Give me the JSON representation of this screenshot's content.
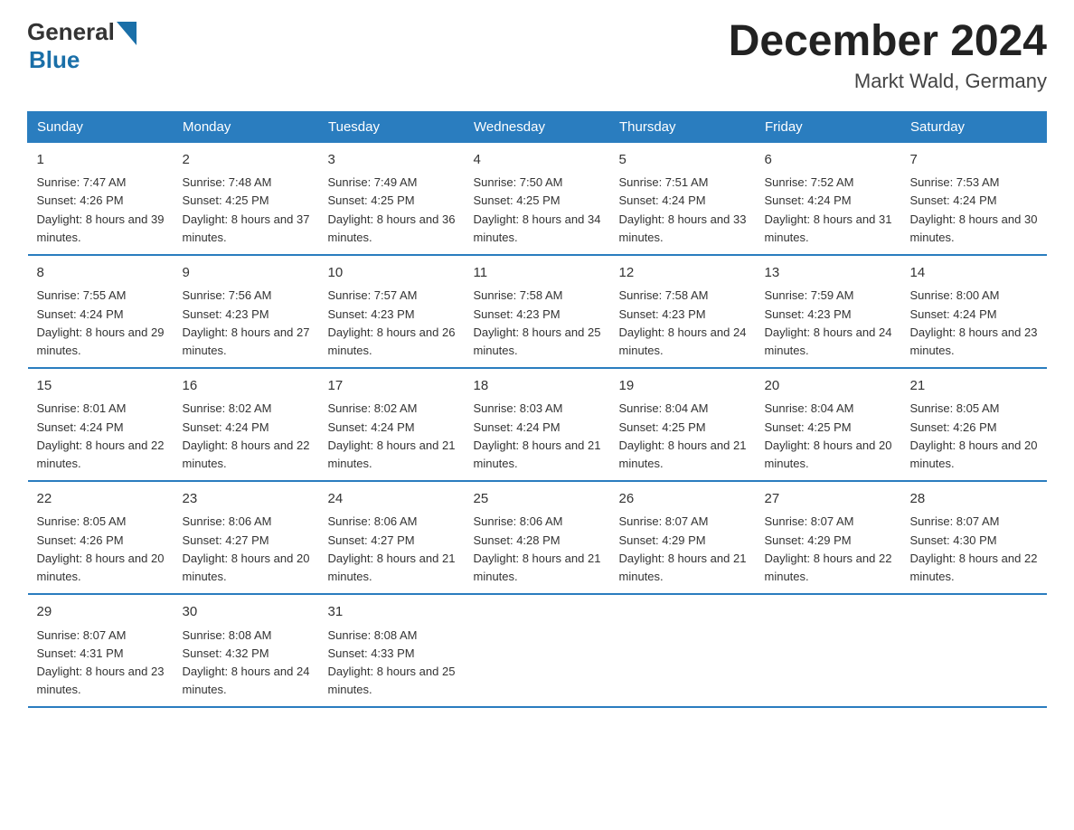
{
  "header": {
    "logo_general": "General",
    "logo_blue": "Blue",
    "month_title": "December 2024",
    "location": "Markt Wald, Germany"
  },
  "days_of_week": [
    "Sunday",
    "Monday",
    "Tuesday",
    "Wednesday",
    "Thursday",
    "Friday",
    "Saturday"
  ],
  "weeks": [
    [
      {
        "day": "1",
        "sunrise": "7:47 AM",
        "sunset": "4:26 PM",
        "daylight": "8 hours and 39 minutes."
      },
      {
        "day": "2",
        "sunrise": "7:48 AM",
        "sunset": "4:25 PM",
        "daylight": "8 hours and 37 minutes."
      },
      {
        "day": "3",
        "sunrise": "7:49 AM",
        "sunset": "4:25 PM",
        "daylight": "8 hours and 36 minutes."
      },
      {
        "day": "4",
        "sunrise": "7:50 AM",
        "sunset": "4:25 PM",
        "daylight": "8 hours and 34 minutes."
      },
      {
        "day": "5",
        "sunrise": "7:51 AM",
        "sunset": "4:24 PM",
        "daylight": "8 hours and 33 minutes."
      },
      {
        "day": "6",
        "sunrise": "7:52 AM",
        "sunset": "4:24 PM",
        "daylight": "8 hours and 31 minutes."
      },
      {
        "day": "7",
        "sunrise": "7:53 AM",
        "sunset": "4:24 PM",
        "daylight": "8 hours and 30 minutes."
      }
    ],
    [
      {
        "day": "8",
        "sunrise": "7:55 AM",
        "sunset": "4:24 PM",
        "daylight": "8 hours and 29 minutes."
      },
      {
        "day": "9",
        "sunrise": "7:56 AM",
        "sunset": "4:23 PM",
        "daylight": "8 hours and 27 minutes."
      },
      {
        "day": "10",
        "sunrise": "7:57 AM",
        "sunset": "4:23 PM",
        "daylight": "8 hours and 26 minutes."
      },
      {
        "day": "11",
        "sunrise": "7:58 AM",
        "sunset": "4:23 PM",
        "daylight": "8 hours and 25 minutes."
      },
      {
        "day": "12",
        "sunrise": "7:58 AM",
        "sunset": "4:23 PM",
        "daylight": "8 hours and 24 minutes."
      },
      {
        "day": "13",
        "sunrise": "7:59 AM",
        "sunset": "4:23 PM",
        "daylight": "8 hours and 24 minutes."
      },
      {
        "day": "14",
        "sunrise": "8:00 AM",
        "sunset": "4:24 PM",
        "daylight": "8 hours and 23 minutes."
      }
    ],
    [
      {
        "day": "15",
        "sunrise": "8:01 AM",
        "sunset": "4:24 PM",
        "daylight": "8 hours and 22 minutes."
      },
      {
        "day": "16",
        "sunrise": "8:02 AM",
        "sunset": "4:24 PM",
        "daylight": "8 hours and 22 minutes."
      },
      {
        "day": "17",
        "sunrise": "8:02 AM",
        "sunset": "4:24 PM",
        "daylight": "8 hours and 21 minutes."
      },
      {
        "day": "18",
        "sunrise": "8:03 AM",
        "sunset": "4:24 PM",
        "daylight": "8 hours and 21 minutes."
      },
      {
        "day": "19",
        "sunrise": "8:04 AM",
        "sunset": "4:25 PM",
        "daylight": "8 hours and 21 minutes."
      },
      {
        "day": "20",
        "sunrise": "8:04 AM",
        "sunset": "4:25 PM",
        "daylight": "8 hours and 20 minutes."
      },
      {
        "day": "21",
        "sunrise": "8:05 AM",
        "sunset": "4:26 PM",
        "daylight": "8 hours and 20 minutes."
      }
    ],
    [
      {
        "day": "22",
        "sunrise": "8:05 AM",
        "sunset": "4:26 PM",
        "daylight": "8 hours and 20 minutes."
      },
      {
        "day": "23",
        "sunrise": "8:06 AM",
        "sunset": "4:27 PM",
        "daylight": "8 hours and 20 minutes."
      },
      {
        "day": "24",
        "sunrise": "8:06 AM",
        "sunset": "4:27 PM",
        "daylight": "8 hours and 21 minutes."
      },
      {
        "day": "25",
        "sunrise": "8:06 AM",
        "sunset": "4:28 PM",
        "daylight": "8 hours and 21 minutes."
      },
      {
        "day": "26",
        "sunrise": "8:07 AM",
        "sunset": "4:29 PM",
        "daylight": "8 hours and 21 minutes."
      },
      {
        "day": "27",
        "sunrise": "8:07 AM",
        "sunset": "4:29 PM",
        "daylight": "8 hours and 22 minutes."
      },
      {
        "day": "28",
        "sunrise": "8:07 AM",
        "sunset": "4:30 PM",
        "daylight": "8 hours and 22 minutes."
      }
    ],
    [
      {
        "day": "29",
        "sunrise": "8:07 AM",
        "sunset": "4:31 PM",
        "daylight": "8 hours and 23 minutes."
      },
      {
        "day": "30",
        "sunrise": "8:08 AM",
        "sunset": "4:32 PM",
        "daylight": "8 hours and 24 minutes."
      },
      {
        "day": "31",
        "sunrise": "8:08 AM",
        "sunset": "4:33 PM",
        "daylight": "8 hours and 25 minutes."
      },
      null,
      null,
      null,
      null
    ]
  ],
  "labels": {
    "sunrise_prefix": "Sunrise: ",
    "sunset_prefix": "Sunset: ",
    "daylight_prefix": "Daylight: "
  }
}
